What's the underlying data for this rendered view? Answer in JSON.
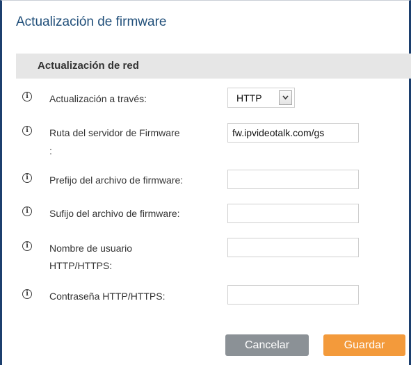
{
  "page": {
    "title": "Actualización de firmware",
    "section_title": "Actualización de red"
  },
  "fields": {
    "upgrade_via": {
      "label": "Actualización a través:",
      "value": "HTTP"
    },
    "server_path": {
      "label": "Ruta del servidor de Firmware",
      "label_suffix": ":",
      "value": "fw.ipvideotalk.com/gs"
    },
    "file_prefix": {
      "label": "Prefijo del archivo de firmware:",
      "value": ""
    },
    "file_suffix": {
      "label": "Sufijo del archivo de firmware:",
      "value": ""
    },
    "http_username": {
      "label": "Nombre de usuario",
      "label_line2": "HTTP/HTTPS:",
      "value": ""
    },
    "http_password": {
      "label": "Contraseña HTTP/HTTPS:",
      "value": ""
    }
  },
  "buttons": {
    "cancel": "Cancelar",
    "save": "Guardar"
  },
  "icons": {
    "info": "info-circle-icon",
    "dropdown": "chevron-down-icon"
  },
  "colors": {
    "title": "#1f4e79",
    "frame_border": "#1c3f6e",
    "section_bg": "#e6e6e6",
    "cancel_bg": "#8b9196",
    "save_bg": "#f39a3b"
  }
}
